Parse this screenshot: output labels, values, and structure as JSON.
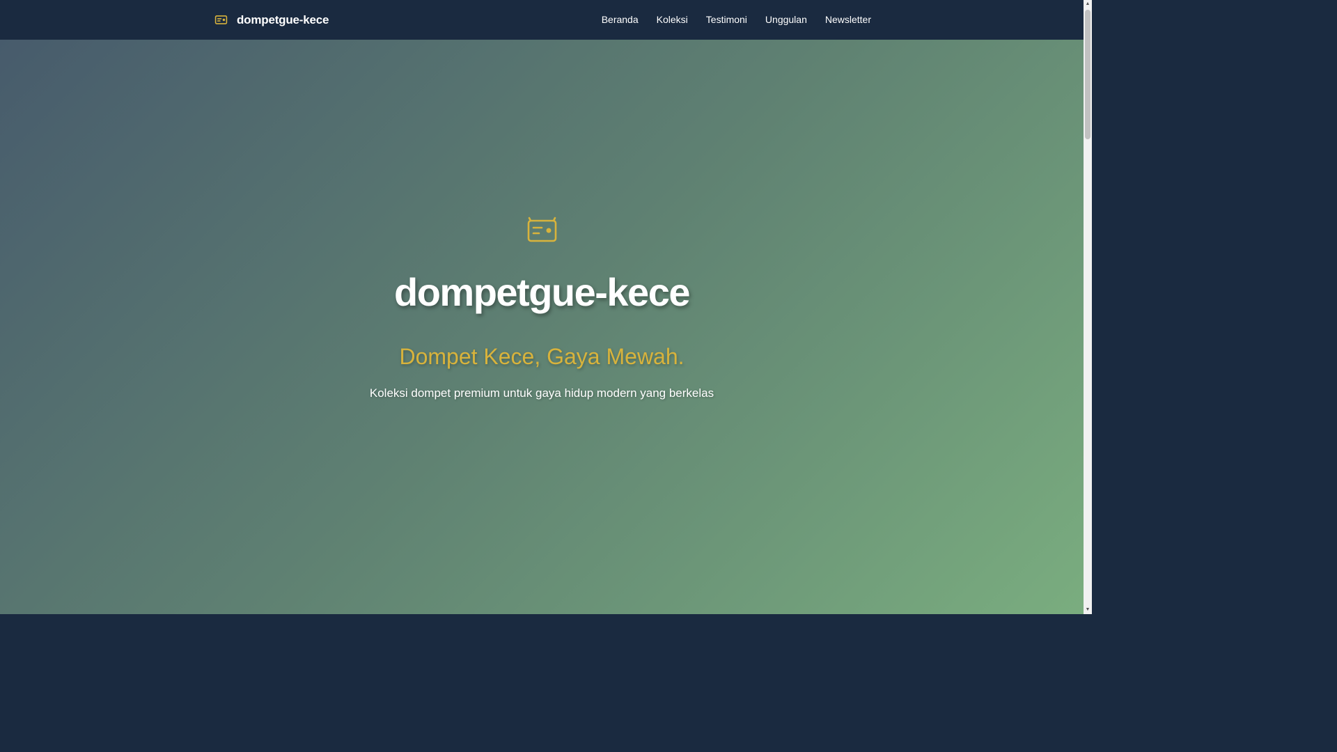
{
  "navbar": {
    "brand": {
      "icon": "wallet-icon",
      "name": "dompetgue-kece"
    },
    "links": [
      {
        "label": "Beranda"
      },
      {
        "label": "Koleksi"
      },
      {
        "label": "Testimoni"
      },
      {
        "label": "Unggulan"
      },
      {
        "label": "Newsletter"
      }
    ]
  },
  "hero": {
    "icon": "wallet-icon",
    "title": "dompetgue-kece",
    "slogan": "Dompet Kece, Gaya Mewah.",
    "description": "Koleksi dompet premium untuk gaya hidup modern yang berkelas"
  },
  "colors": {
    "navbar_bg": "#1a2a40",
    "accent_gold": "#d8b33c",
    "hero_gradient_start": "#475b6c",
    "hero_gradient_end": "#7aad7f",
    "text": "#ffffff"
  },
  "scrollbar": {
    "up_icon": "scroll-up-arrow-icon",
    "down_icon": "scroll-down-arrow-icon"
  }
}
